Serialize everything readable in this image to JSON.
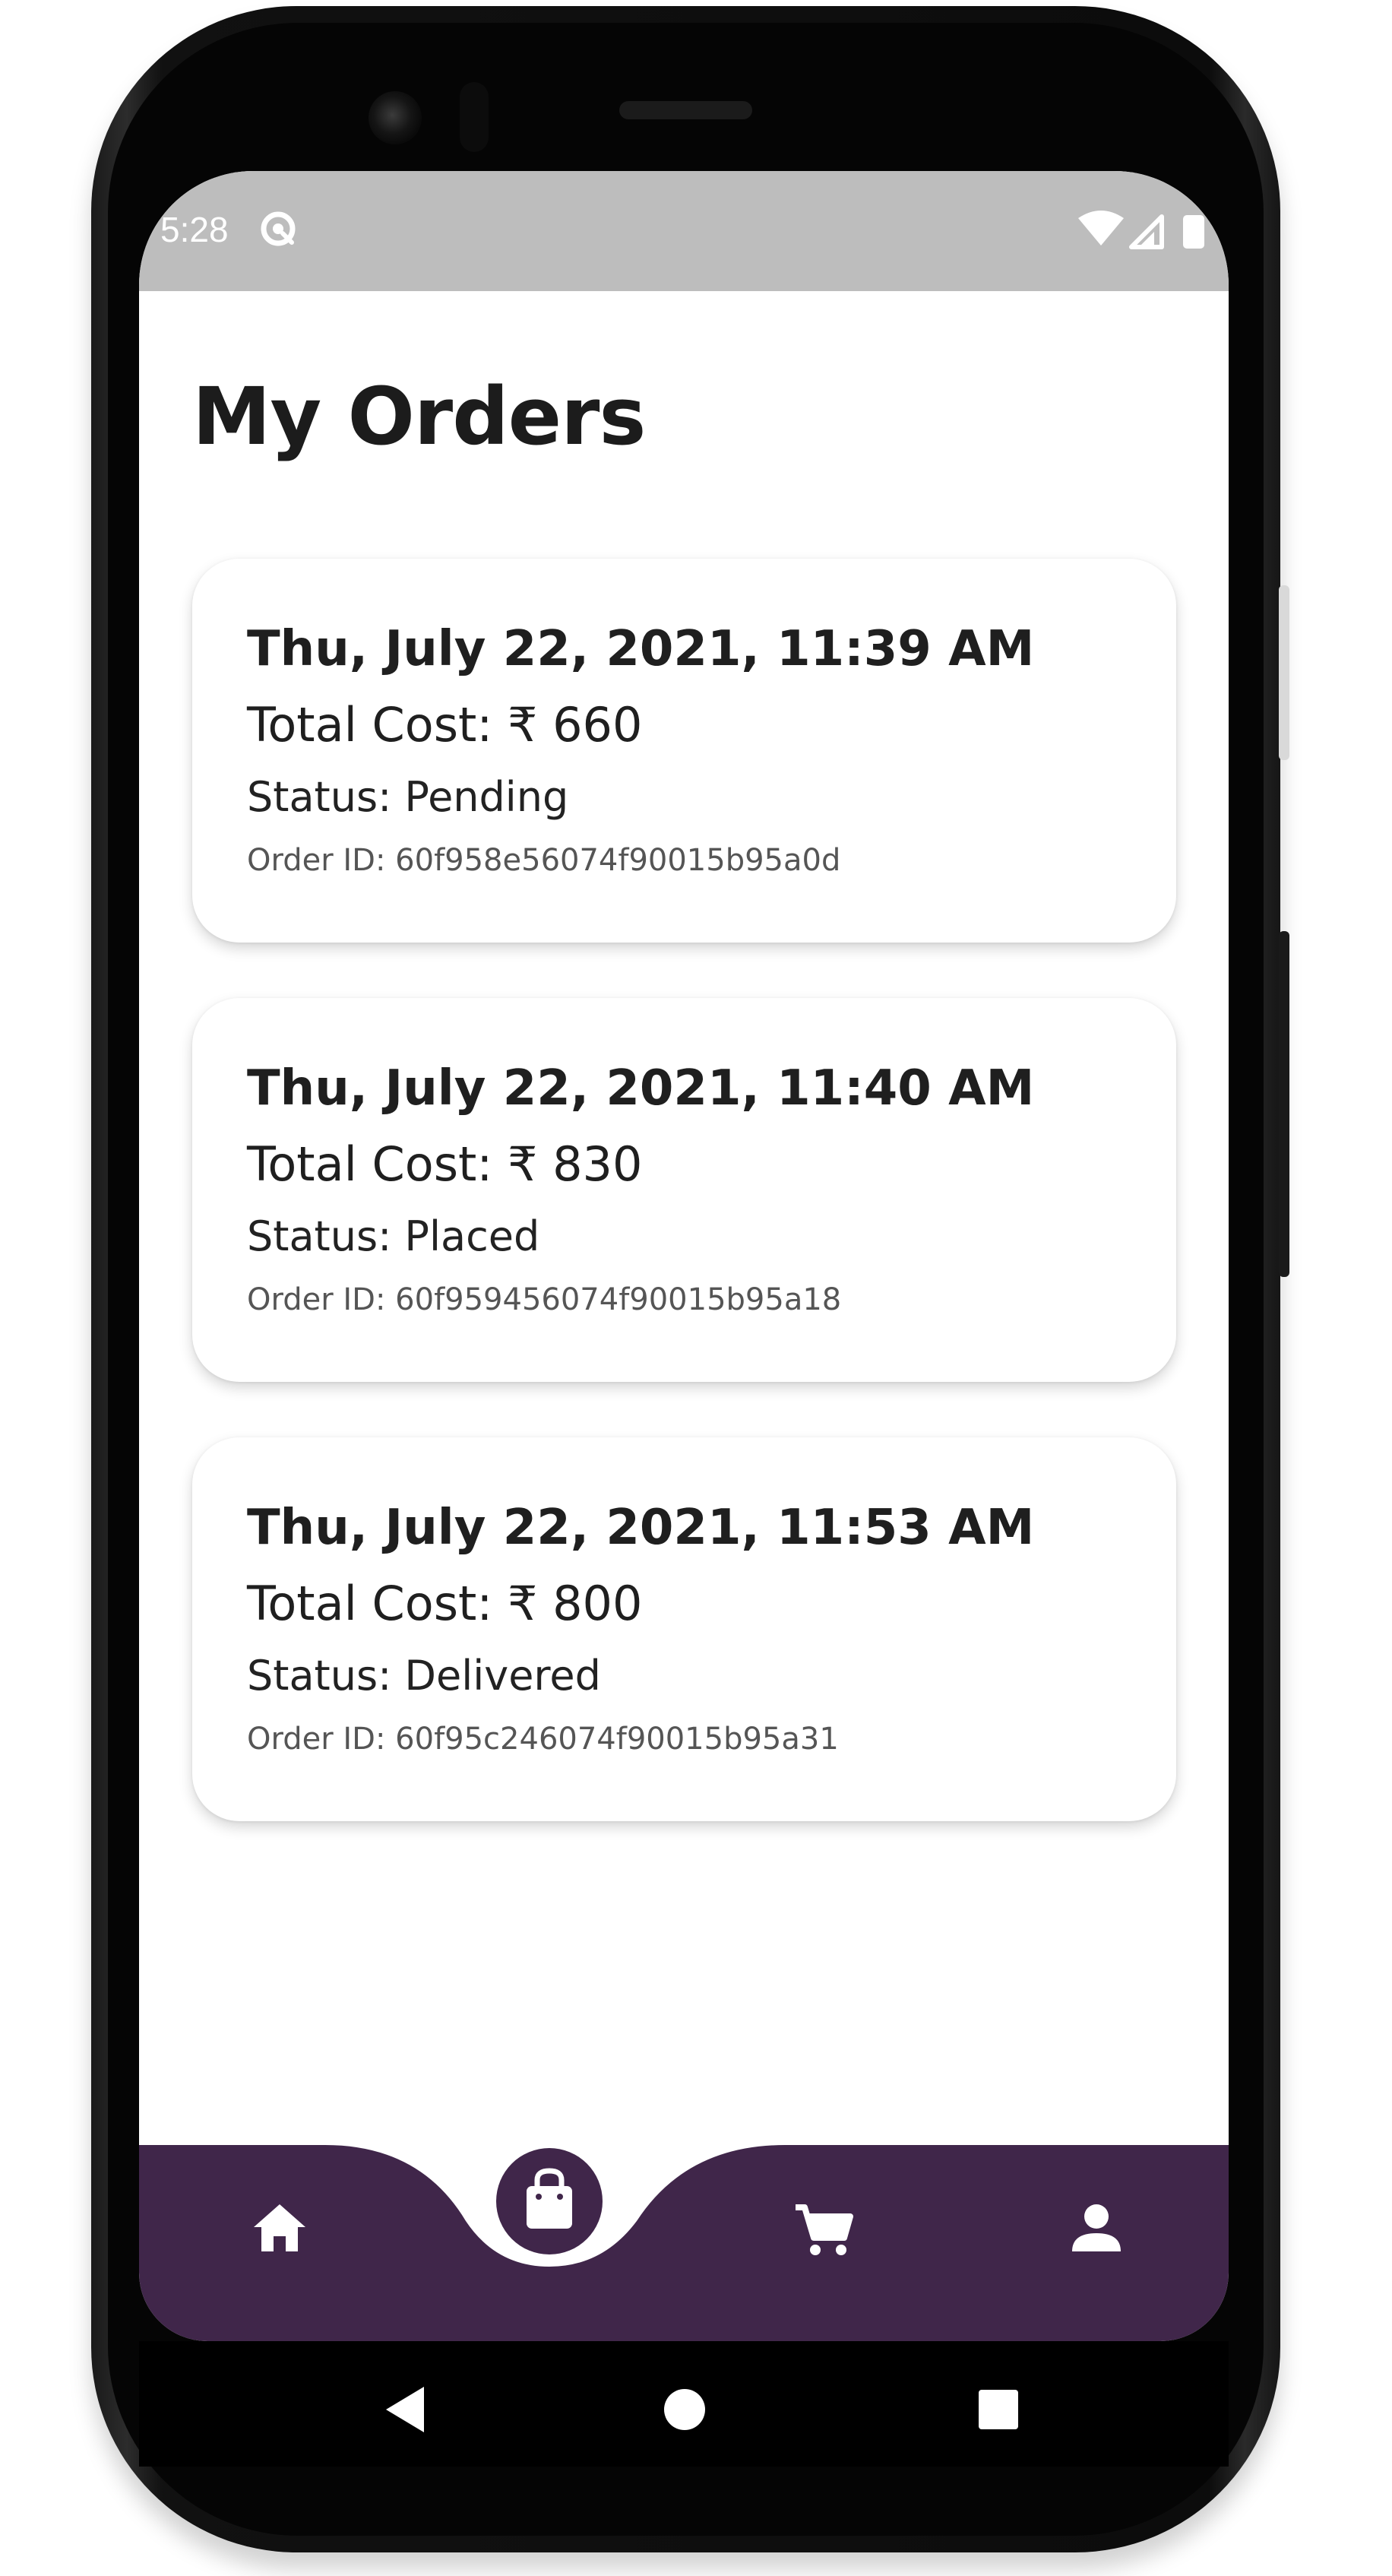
{
  "status_bar": {
    "time": "5:28"
  },
  "page": {
    "title": "My Orders"
  },
  "orders": [
    {
      "date": "Thu, July 22, 2021, 11:39 AM",
      "total_cost": "Total Cost: ₹ 660",
      "status": "Status: Pending",
      "order_id": "Order ID: 60f958e56074f90015b95a0d"
    },
    {
      "date": "Thu, July 22, 2021, 11:40 AM",
      "total_cost": "Total Cost: ₹ 830",
      "status": "Status: Placed",
      "order_id": "Order ID: 60f959456074f90015b95a18"
    },
    {
      "date": "Thu, July 22, 2021, 11:53 AM",
      "total_cost": "Total Cost: ₹ 800",
      "status": "Status: Delivered",
      "order_id": "Order ID: 60f95c246074f90015b95a31"
    }
  ],
  "bottom_nav": {
    "items": [
      {
        "icon": "home-icon",
        "active": false
      },
      {
        "icon": "shopping-bag-icon",
        "active": true
      },
      {
        "icon": "cart-icon",
        "active": false
      },
      {
        "icon": "person-icon",
        "active": false
      }
    ]
  },
  "system_nav": {
    "items": [
      {
        "icon": "back-icon"
      },
      {
        "icon": "home-circle-icon"
      },
      {
        "icon": "recents-icon"
      }
    ]
  },
  "colors": {
    "nav_bar": "#40264a",
    "status_bar": "#bdbdbd",
    "text_primary": "#1f1f1f",
    "text_secondary": "#555555",
    "background": "#ffffff"
  }
}
